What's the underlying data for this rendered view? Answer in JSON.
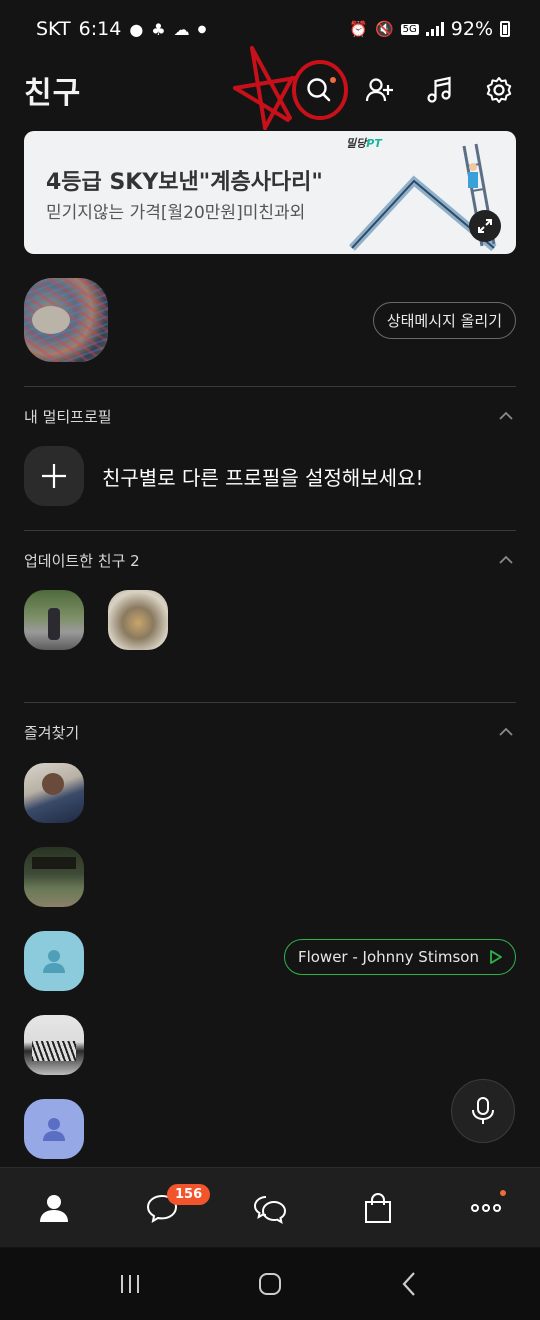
{
  "status_bar": {
    "carrier": "SKT",
    "time": "6:14",
    "battery": "92%",
    "network": "5G"
  },
  "header": {
    "title": "친구",
    "actions": [
      "search-icon",
      "add-friend-icon",
      "music-icon",
      "settings-icon"
    ]
  },
  "banner": {
    "title": "4등급 SKY보낸\"계층사다리\"",
    "subtitle": "믿기지않는 가격[월20만원]미친과외",
    "brand_main": "밀당",
    "brand_accent": "PT"
  },
  "profile": {
    "status_button": "상태메시지 올리기"
  },
  "multi_profile": {
    "section_title": "내 멀티프로필",
    "prompt": "친구별로 다른 프로필을 설정해보세요!"
  },
  "updated_friends": {
    "section_title": "업데이트한 친구 2"
  },
  "favorites": {
    "section_title": "즐겨찾기",
    "music": {
      "label": "Flower - Johnny Stimson"
    }
  },
  "bottom_nav": {
    "chat_badge": "156"
  },
  "colors": {
    "accent": "#f2552c",
    "music_border": "#2fb24a",
    "background": "#141414"
  }
}
